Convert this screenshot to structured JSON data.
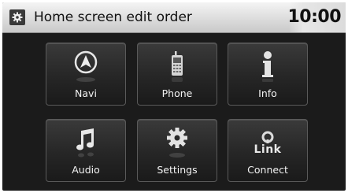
{
  "header": {
    "title": "Home screen edit order",
    "clock": "10:00",
    "icon": "gear-icon"
  },
  "tiles": [
    {
      "label": "Navi",
      "icon": "compass-icon"
    },
    {
      "label": "Phone",
      "icon": "phone-icon"
    },
    {
      "label": "Info",
      "icon": "info-icon"
    },
    {
      "label": "Audio",
      "icon": "music-note-icon"
    },
    {
      "label": "Settings",
      "icon": "gear-icon"
    },
    {
      "label": "Connect",
      "icon": "link-icon",
      "icon_text": "Link"
    }
  ],
  "colors": {
    "header_bg": "#dcdcdc",
    "screen_bg": "#1b1b1b",
    "tile_bg": "#2a2a2a",
    "label_text": "#f2f2f2"
  }
}
